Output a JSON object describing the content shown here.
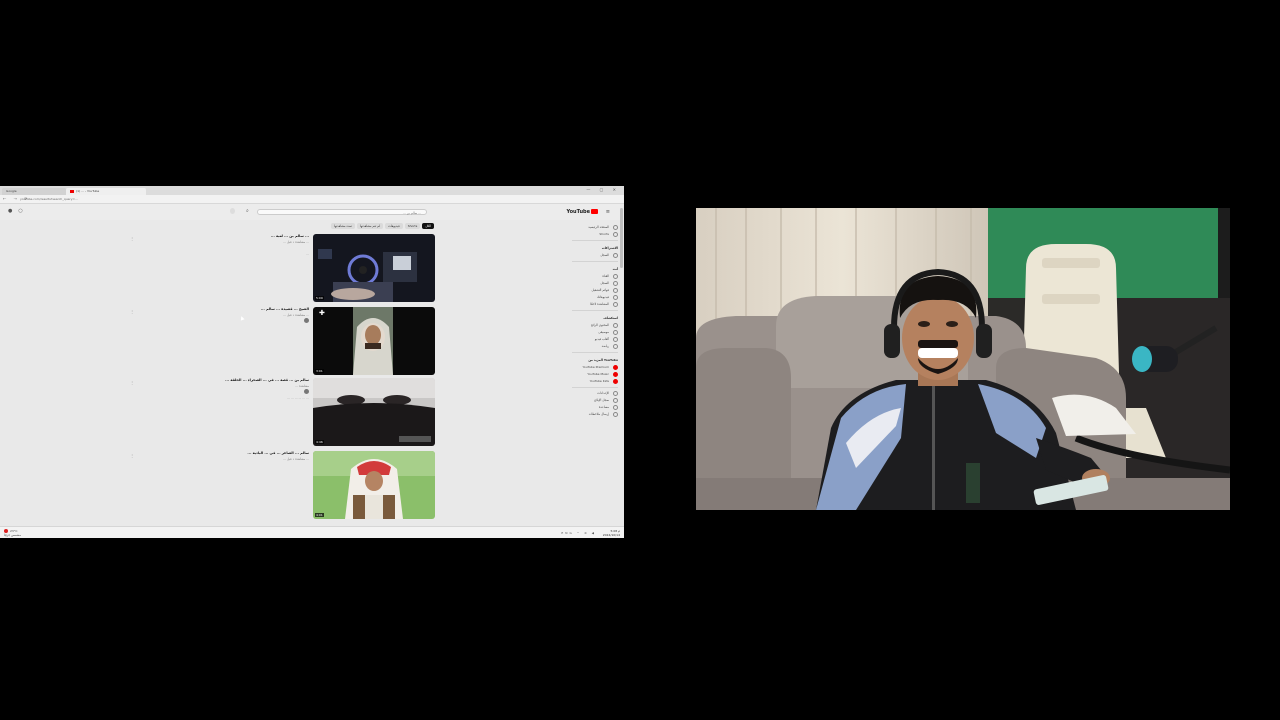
{
  "browser": {
    "tabs": [
      {
        "label": "Google"
      },
      {
        "label": "(1) ... - YouTube"
      }
    ],
    "window_controls": "— ▢ ✕",
    "nav": "← → ⟳",
    "address": "youtube.com/results?search_query=..."
  },
  "youtube": {
    "logo_text": "YouTube",
    "search_placeholder": "... سالم بن ...",
    "chips": [
      {
        "label": "الكل",
        "active": true
      },
      {
        "label": "Shorts",
        "active": false
      },
      {
        "label": "فيديوهات",
        "active": false
      },
      {
        "label": "لم تتم مشاهدتها",
        "active": false
      },
      {
        "label": "تمت مشاهدتها",
        "active": false
      },
      {
        "label": "مباشر",
        "active": false
      }
    ],
    "sidebar": {
      "items_top": [
        {
          "label": "الصفحة الرئيسية",
          "icon": "home-icon"
        },
        {
          "label": "Shorts",
          "icon": "shorts-icon"
        }
      ],
      "subs_head": "الاشتراكات",
      "subs": [
        {
          "label": "السجل",
          "icon": "history-icon"
        }
      ],
      "you_head": "أنت",
      "you_items": [
        {
          "label": "القناة",
          "icon": "channel-icon"
        },
        {
          "label": "السجل",
          "icon": "history-icon"
        },
        {
          "label": "قوائم التشغيل",
          "icon": "playlist-icon"
        },
        {
          "label": "فيديوهاتك",
          "icon": "videos-icon"
        },
        {
          "label": "المشاهدة لاحقًا",
          "icon": "clock-icon"
        }
      ],
      "explore_head": "استكشاف",
      "explore_items": [
        {
          "label": "المحتوى الرائج",
          "icon": "fire-icon"
        },
        {
          "label": "موسيقى",
          "icon": "music-icon"
        },
        {
          "label": "ألعاب فيديو",
          "icon": "game-icon"
        },
        {
          "label": "رياضة",
          "icon": "sport-icon"
        }
      ],
      "more_head": "المزيد من YouTube",
      "more_items": [
        {
          "label": "YouTube Premium",
          "icon": "yt-red-icon"
        },
        {
          "label": "YouTube Music",
          "icon": "yt-red-icon"
        },
        {
          "label": "YouTube Kids",
          "icon": "yt-red-icon"
        }
      ],
      "settings_items": [
        {
          "label": "الإعدادات",
          "icon": "gear-icon"
        },
        {
          "label": "سجل الإبلاغ",
          "icon": "flag-icon"
        },
        {
          "label": "مساعدة",
          "icon": "help-icon"
        },
        {
          "label": "إرسال ملاحظات",
          "icon": "feedback-icon"
        }
      ]
    },
    "videos": [
      {
        "title": "... سالم بن ... لعبة ...",
        "meta": "... مشاهدة • قبل ...",
        "desc": "...",
        "duration": "5:09"
      },
      {
        "title": "... الشيخ ... قصيدة ... سالم",
        "meta": "... مشاهدة • قبل ...",
        "desc": "",
        "duration": "3:01"
      },
      {
        "title": "... سالم بن ... قصة ... في ... الصحراء ... الحلقة",
        "meta": "... مشاهدة",
        "desc": "... ... ... ... ... ...",
        "duration": "4:46"
      },
      {
        "title": "... سالم ... الشاعر ... في ... البادية",
        "meta": "... مشاهدة • قبل ...",
        "desc": "",
        "duration": "4:01"
      }
    ]
  },
  "taskbar": {
    "weather_line1": "23°C",
    "weather_line2": "مشمس جزئيًا",
    "time": "5:08 م",
    "date": "2024/10/14",
    "tray": "ENG ^ ≋ ◀"
  }
}
